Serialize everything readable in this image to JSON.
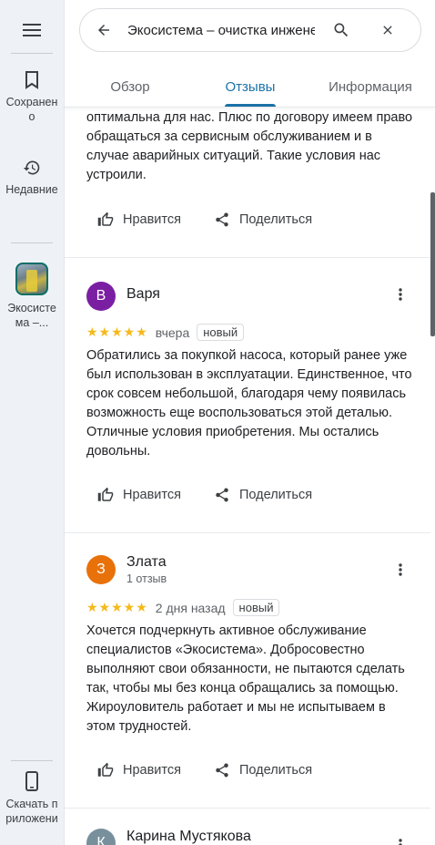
{
  "rail": {
    "saved_label": "Сохранено",
    "recent_label": "Недавние",
    "place_label": "Экосистема –...",
    "download_label": "Скачать приложение"
  },
  "search": {
    "query": "Экосистема – очистка инженерных систем"
  },
  "tabs": [
    {
      "label": "Обзор"
    },
    {
      "label": "Отзывы"
    },
    {
      "label": "Информация"
    }
  ],
  "actions": {
    "like": "Нравится",
    "share": "Поделиться"
  },
  "partial_review": {
    "text": "оптимальна для нас. Плюс по договору имеем право обращаться за сервисным обслуживанием и в случае аварийных ситуаций. Такие условия нас устроили."
  },
  "reviews": [
    {
      "initial": "В",
      "name": "Варя",
      "subtitle": "",
      "stars": "★★★★★",
      "when": "вчера",
      "badge": "новый",
      "text": "Обратились за покупкой насоса, который ранее уже был использован в эксплуатации. Единственное, что срок совсем небольшой, благодаря чему появилась возможность еще воспользоваться этой деталью. Отличные условия приобретения. Мы остались довольны.",
      "avatar_color": "#7b1fa2"
    },
    {
      "initial": "З",
      "name": "Злата",
      "subtitle": "1 отзыв",
      "stars": "★★★★★",
      "when": "2 дня назад",
      "badge": "новый",
      "text": "Хочется подчеркнуть активное обслуживание специалистов «Экосистема». Добросовестно выполняют свои обязанности, не пытаются сделать так, чтобы мы без конца обращались за помощью. Жироуловитель работает и мы не испытываем в этом трудностей.",
      "avatar_color": "#e8710a"
    },
    {
      "initial": "К",
      "name": "Карина Мустякова",
      "avatar_color": "#78909c"
    }
  ]
}
